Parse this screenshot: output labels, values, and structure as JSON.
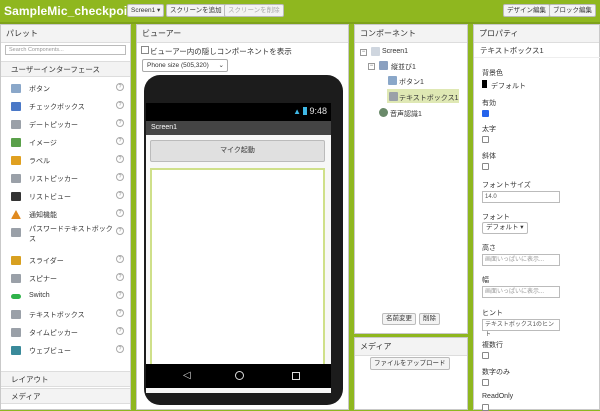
{
  "app": {
    "title": "SampleMic_checkpoint1"
  },
  "toolbar": {
    "screen_select": "Screen1 ▾",
    "add_screen": "スクリーンを追加",
    "remove_screen": "スクリーンを削除",
    "designer": "デザイン編集",
    "blocks": "ブロック編集"
  },
  "palette": {
    "header": "パレット",
    "search_placeholder": "Search Components...",
    "category_ui": "ユーザーインターフェース",
    "items": [
      {
        "label": "ボタン",
        "icon": "button-icon",
        "color": "#8aa7c9"
      },
      {
        "label": "チェックボックス",
        "icon": "checkbox-icon",
        "color": "#4a78c7"
      },
      {
        "label": "デートピッカー",
        "icon": "datepicker-icon",
        "color": "#9aa0a8"
      },
      {
        "label": "イメージ",
        "icon": "image-icon",
        "color": "#5aa04a"
      },
      {
        "label": "ラベル",
        "icon": "label-icon",
        "color": "#e0a020"
      },
      {
        "label": "リストピッカー",
        "icon": "listpicker-icon",
        "color": "#9aa0a8"
      },
      {
        "label": "リストビュー",
        "icon": "listview-icon",
        "color": "#333333"
      },
      {
        "label": "通知機能",
        "icon": "notifier-icon",
        "color": "#e08a20"
      },
      {
        "label": "パスワードテキストボックス",
        "label2": "ス",
        "icon": "passwordtextbox-icon",
        "color": "#9aa0a8"
      },
      {
        "label": "スライダー",
        "icon": "slider-icon",
        "color": "#d8a020"
      },
      {
        "label": "スピナー",
        "icon": "spinner-icon",
        "color": "#9aa0a8"
      },
      {
        "label": "Switch",
        "icon": "switch-icon",
        "color": "#2fb34a"
      },
      {
        "label": "テキストボックス",
        "icon": "textbox-icon",
        "color": "#9aa0a8"
      },
      {
        "label": "タイムピッカー",
        "icon": "timepicker-icon",
        "color": "#9aa0a8"
      },
      {
        "label": "ウェブビュー",
        "icon": "webviewer-icon",
        "color": "#3a8a9a"
      }
    ],
    "category_layout": "レイアウト",
    "category_media": "メディア"
  },
  "viewer": {
    "header": "ビューアー",
    "hidden_label": "ビューアー内の隠しコンポーネントを表示",
    "size_select": "Phone size (505,320)",
    "status_time": "9:48",
    "screen_title": "Screen1",
    "mic_button": "マイク起動"
  },
  "components": {
    "header": "コンポーネント",
    "tree": {
      "screen": "Screen1",
      "arrangement": "縦並び1",
      "button": "ボタン1",
      "textbox": "テキストボックス1",
      "speech": "音声認識1"
    },
    "rename": "名前変更",
    "delete": "削除"
  },
  "media": {
    "header": "メディア",
    "upload": "ファイルをアップロード"
  },
  "properties": {
    "header": "プロパティ",
    "component": "テキストボックス1",
    "bg_color_label": "背景色",
    "bg_color_value": "デフォルト",
    "enabled_label": "有効",
    "enabled": true,
    "bold_label": "太字",
    "bold": false,
    "italic_label": "斜体",
    "italic": false,
    "font_size_label": "フォントサイズ",
    "font_size_value": "14.0",
    "font_label": "フォント",
    "font_value": "デフォルト ▾",
    "height_label": "高さ",
    "height_value": "画面いっぱいに表示...",
    "width_label": "幅",
    "width_value": "画面いっぱいに表示...",
    "hint_label": "ヒント",
    "hint_value": "テキストボックス1のヒント",
    "multiline_label": "複数行",
    "multiline": false,
    "numbers_only_label": "数字のみ",
    "numbers_only": false,
    "readonly_label": "ReadOnly",
    "readonly": false
  },
  "colors": {
    "brand_green": "#8fb71f",
    "checkbox_on": "#2563eb",
    "textbox_border": "#cfe08a"
  }
}
